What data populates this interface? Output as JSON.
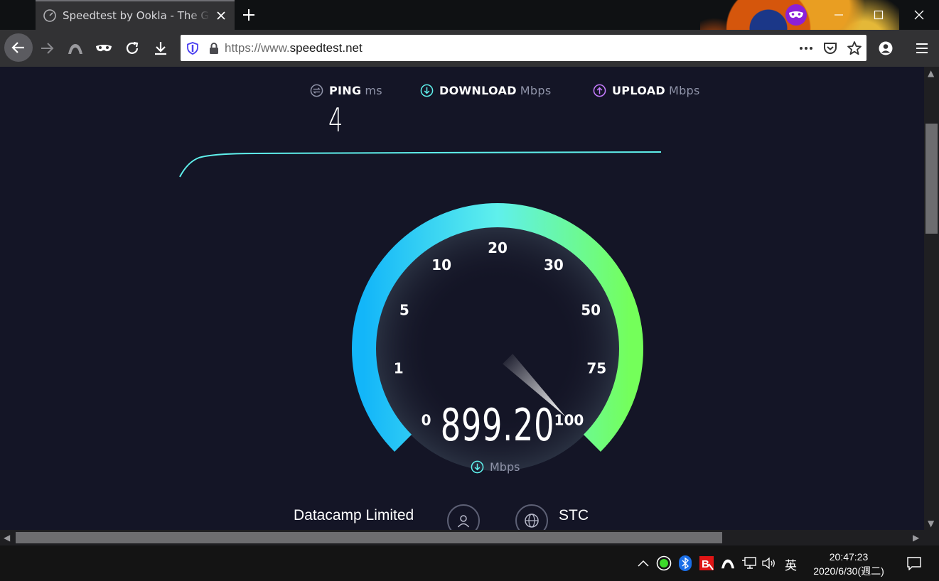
{
  "browser": {
    "tab_title": "Speedtest by Ookla - The Global Broadband Speed Test",
    "url_scheme": "https://www.",
    "url_host": "speedtest.net"
  },
  "stats": {
    "ping_label": "PING",
    "ping_unit": "ms",
    "ping_value": "4",
    "download_label": "DOWNLOAD",
    "download_unit": "Mbps",
    "upload_label": "UPLOAD",
    "upload_unit": "Mbps"
  },
  "gauge": {
    "value": "899.20",
    "unit": "Mbps",
    "tick_labels": [
      "0",
      "1",
      "5",
      "10",
      "20",
      "30",
      "50",
      "75",
      "100"
    ],
    "needle_fraction": 1.0,
    "colors": {
      "start": "#13b6f9",
      "mid": "#5ff0ec",
      "end": "#74ff5a"
    }
  },
  "server": {
    "isp": "Datacamp Limited",
    "host": "STC"
  },
  "taskbar": {
    "ime": "英",
    "time": "20:47:23",
    "date": "2020/6/30(週二)"
  }
}
